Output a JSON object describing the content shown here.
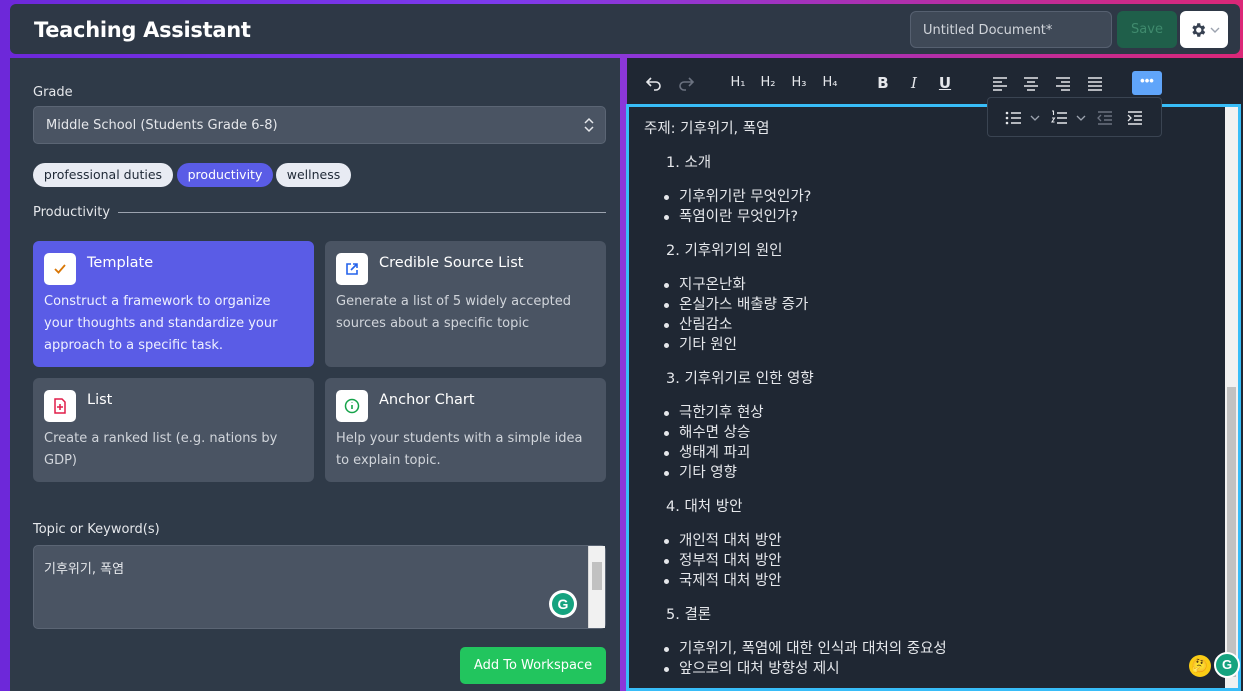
{
  "header": {
    "app_title": "Teaching Assistant",
    "document_title": "Untitled Document*",
    "save_label": "Save"
  },
  "left": {
    "grade_label": "Grade",
    "grade_value": "Middle School (Students Grade 6-8)",
    "chips": [
      {
        "label": "professional duties",
        "active": false
      },
      {
        "label": "productivity",
        "active": true
      },
      {
        "label": "wellness",
        "active": false
      }
    ],
    "section_title": "Productivity",
    "cards": [
      {
        "title": "Template",
        "desc": "Construct a framework to organize your thoughts and standardize your approach to a specific task.",
        "icon": "check-icon",
        "selected": true
      },
      {
        "title": "Credible Source List",
        "desc": "Generate a list of 5 widely accepted sources about a specific topic",
        "icon": "external-link-icon",
        "selected": false
      },
      {
        "title": "List",
        "desc": "Create a ranked list (e.g. nations by GDP)",
        "icon": "file-plus-icon",
        "selected": false
      },
      {
        "title": "Anchor Chart",
        "desc": "Help your students with a simple idea to explain topic.",
        "icon": "info-icon",
        "selected": false
      }
    ],
    "topic_label": "Topic or Keyword(s)",
    "topic_value": "기후위기, 폭염",
    "add_button": "Add To Workspace"
  },
  "toolbar": {
    "h1": "H₁",
    "h2": "H₂",
    "h3": "H₃",
    "h4": "H₄",
    "bold": "B",
    "italic": "I",
    "underline": "U",
    "more": "•••"
  },
  "editor": {
    "heading": "주제: 기후위기, 폭염",
    "sections": [
      {
        "title": "1. 소개",
        "items": [
          "기후위기란 무엇인가?",
          "폭염이란 무엇인가?"
        ]
      },
      {
        "title": "2. 기후위기의 원인",
        "items": [
          "지구온난화",
          "온실가스 배출량 증가",
          "산림감소",
          "기타 원인"
        ]
      },
      {
        "title": "3. 기후위기로 인한 영향",
        "items": [
          "극한기후 현상",
          "해수면 상승",
          "생태계 파괴",
          "기타 영향"
        ]
      },
      {
        "title": "4. 대처 방안",
        "items": [
          "개인적 대처 방안",
          "정부적 대처 방안",
          "국제적 대처 방안"
        ]
      },
      {
        "title": "5. 결론",
        "items": [
          "기후위기, 폭염에 대한 인식과 대처의 중요성",
          "앞으로의 대처 방향성 제시"
        ]
      }
    ]
  },
  "colors": {
    "accent": "#5a5ce6",
    "success": "#22c55e",
    "editor_border": "#38bdf8"
  }
}
